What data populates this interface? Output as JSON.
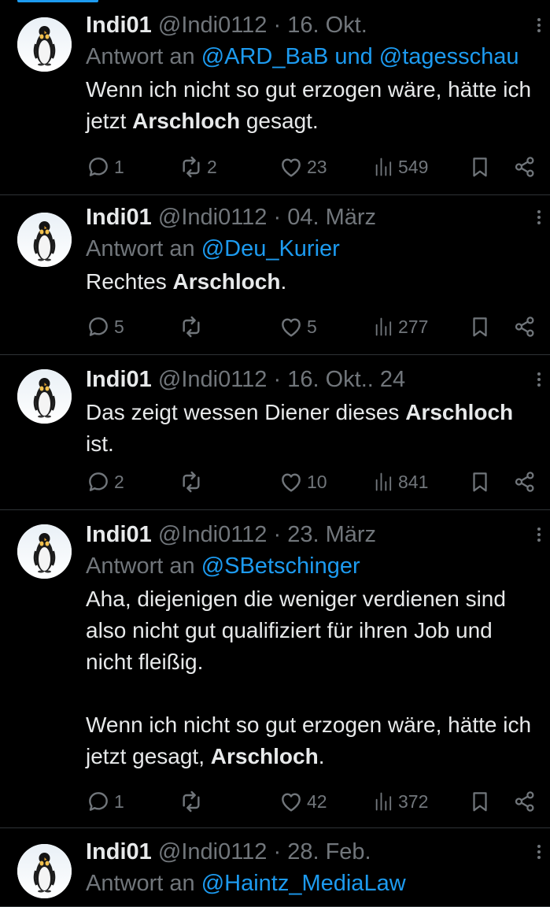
{
  "colors": {
    "background": "#000000",
    "text": "#e7e9ea",
    "secondary": "#71767b",
    "accent": "#1d9bf0",
    "divider": "#2f3336"
  },
  "icons": {
    "reply": "speech-bubble-icon",
    "retweet": "repost-arrows-icon",
    "like": "heart-icon",
    "views": "bar-chart-icon",
    "bookmark": "bookmark-icon",
    "share": "share-icon",
    "more": "vertical-dots-icon",
    "avatar": "penguin-avatar"
  },
  "tweets": [
    {
      "name": "Indi01",
      "handle": "@Indi0112",
      "sep": " · ",
      "date": "16. Okt.",
      "reply_prefix": "Antwort an ",
      "reply_to": "@ARD_BaB und @tagesschau",
      "body": [
        [
          {
            "t": "Wenn ich nicht so gut erzogen wäre, hätte ich jetzt "
          },
          {
            "t": "Arschloch",
            "b": true
          },
          {
            "t": " gesagt."
          }
        ]
      ],
      "replies": "1",
      "retweets": "2",
      "likes": "23",
      "views": "549"
    },
    {
      "name": "Indi01",
      "handle": "@Indi0112",
      "sep": " · ",
      "date": "04. März",
      "reply_prefix": "Antwort an ",
      "reply_to": "@Deu_Kurier",
      "body": [
        [
          {
            "t": "Rechtes "
          },
          {
            "t": "Arschloch",
            "b": true
          },
          {
            "t": "."
          }
        ]
      ],
      "replies": "5",
      "retweets": "",
      "likes": "5",
      "views": "277"
    },
    {
      "name": "Indi01",
      "handle": "@Indi0112",
      "sep": " · ",
      "date": "16. Okt.. 24",
      "reply_prefix": "",
      "reply_to": "",
      "body": [
        [
          {
            "t": "Das zeigt wessen Diener dieses "
          },
          {
            "t": "Arschloch",
            "b": true
          },
          {
            "t": " ist."
          }
        ]
      ],
      "replies": "2",
      "retweets": "",
      "likes": "10",
      "views": "841"
    },
    {
      "name": "Indi01",
      "handle": "@Indi0112",
      "sep": " · ",
      "date": "23. März",
      "reply_prefix": "Antwort an ",
      "reply_to": "@SBetschinger",
      "body": [
        [
          {
            "t": "Aha, diejenigen die weniger verdienen sind also nicht gut qualifiziert für ihren Job und nicht fleißig."
          }
        ],
        [
          {
            "t": "Wenn ich nicht so gut erzogen wäre, hätte ich jetzt gesagt, "
          },
          {
            "t": "Arschloch",
            "b": true
          },
          {
            "t": "."
          }
        ]
      ],
      "replies": "1",
      "retweets": "",
      "likes": "42",
      "views": "372"
    },
    {
      "name": "Indi01",
      "handle": "@Indi0112",
      "sep": " · ",
      "date": "28. Feb.",
      "reply_prefix": "Antwort an ",
      "reply_to": "@Haintz_MediaLaw",
      "body": [],
      "replies": "",
      "retweets": "",
      "likes": "",
      "views": ""
    }
  ]
}
